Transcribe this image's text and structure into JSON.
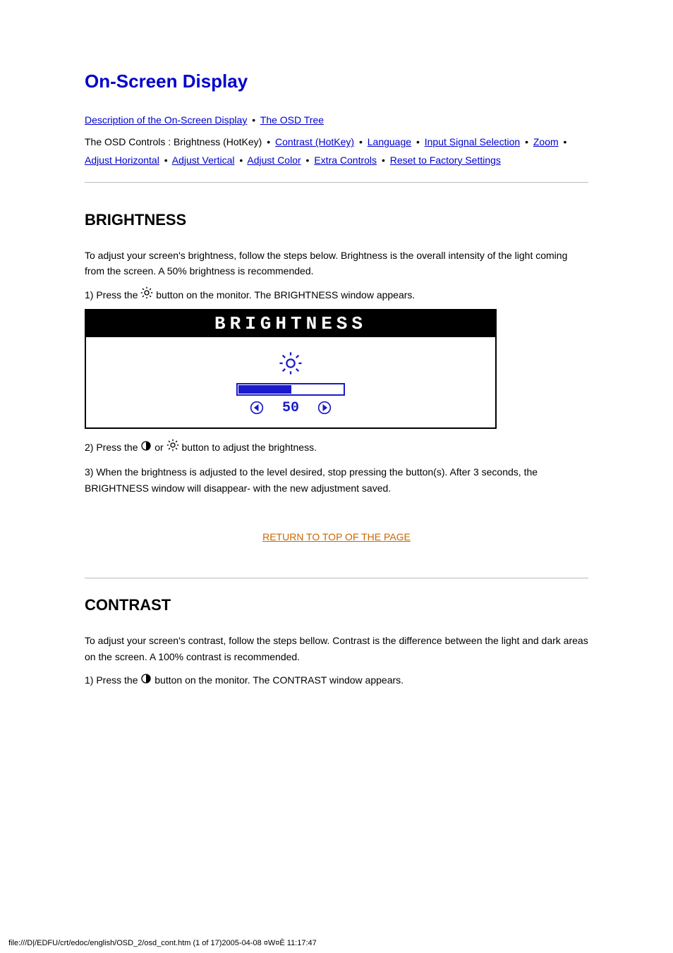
{
  "title": "On-Screen Display",
  "breadcrumb": [
    {
      "label": "Description of the On-Screen Display",
      "link": true
    },
    {
      "label": "The OSD Tree",
      "link": true
    }
  ],
  "subnav": {
    "prefix": "The OSD Controls :",
    "items": [
      {
        "label": "Brightness (HotKey)",
        "link": false
      },
      {
        "label": "Contrast (HotKey)",
        "link": true
      },
      {
        "label": "Language",
        "link": true
      },
      {
        "label": "Input Signal Selection",
        "link": true
      },
      {
        "label": "Zoom",
        "link": true
      },
      {
        "label": "Adjust Horizontal",
        "link": true
      },
      {
        "label": "Adjust Vertical",
        "link": true
      },
      {
        "label": "Adjust Color",
        "link": true
      },
      {
        "label": "Extra Controls",
        "link": true
      },
      {
        "label": "Reset to Factory Settings",
        "link": true
      }
    ]
  },
  "sections": {
    "brightness": {
      "heading": "BRIGHTNESS",
      "intro": "To adjust your screen's brightness, follow the steps below. Brightness is the overall intensity of the light coming from the screen. A 50% brightness is recommended.",
      "step1_prefix": "1) Press the ",
      "step1_suffix": " button on the monitor. The BRIGHTNESS window appears.",
      "osd_title": "BRIGHTNESS",
      "osd_value": "50",
      "step2_prefix": "2) Press the ",
      "step2_mid": " or ",
      "step2_suffix": " button to adjust the brightness.",
      "step3": "3) When the brightness is adjusted to the level desired, stop pressing the button(s). After 3 seconds, the BRIGHTNESS window will disappear- with the new adjustment saved."
    },
    "contrast": {
      "heading": "CONTRAST",
      "intro": "To adjust your screen's contrast, follow the steps bellow. Contrast is the difference between the light and dark areas on the screen. A 100% contrast is recommended.",
      "step1_prefix": "1) Press the ",
      "step1_suffix": " button on the monitor. The CONTRAST window appears."
    }
  },
  "return": {
    "label": "RETURN TO TOP OF THE PAGE"
  },
  "footer": {
    "path": "file:///D|/EDFU/crt/edoc/english/OSD_2/osd_cont.htm (1 of 17)2005-04-08 ¤W¤È 11:17:47"
  }
}
